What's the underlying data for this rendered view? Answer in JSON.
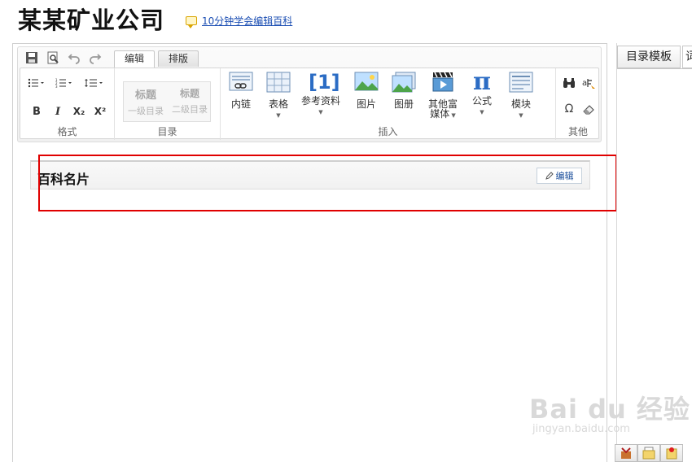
{
  "page": {
    "title": "某某矿业公司",
    "help_link": "10分钟学会编辑百科"
  },
  "toolbar": {
    "tabs": [
      {
        "label": "编辑",
        "active": true
      },
      {
        "label": "排版",
        "active": false
      }
    ],
    "groups": {
      "format": {
        "label": "格式"
      },
      "toc": {
        "label": "目录",
        "items": [
          {
            "big": "标题",
            "small": "一级目录"
          },
          {
            "big": "标题",
            "small": "二级目录"
          }
        ]
      },
      "insert": {
        "label": "插入",
        "items": [
          {
            "label": "内链"
          },
          {
            "label": "表格"
          },
          {
            "label": "参考资料",
            "glyph": "[1]"
          },
          {
            "label": "图片"
          },
          {
            "label": "图册"
          },
          {
            "label": "其他富",
            "label2": "媒体"
          },
          {
            "label": "公式",
            "glyph": "π"
          },
          {
            "label": "模块"
          }
        ]
      },
      "other": {
        "label": "其他"
      }
    },
    "format_buttons": {
      "bold": "B",
      "italic": "I",
      "subscript": "X₂",
      "superscript": "X²"
    }
  },
  "card": {
    "title": "百科名片",
    "edit_label": "编辑"
  },
  "right_panel": {
    "tab_label": "目录模板",
    "tab2_label": "词"
  },
  "watermark": {
    "main": "Bai du 经验",
    "sub": "jingyan.baidu.com"
  },
  "colors": {
    "link": "#1b4eb3",
    "highlight": "#e00000",
    "accent_blue": "#2b6cc4"
  }
}
